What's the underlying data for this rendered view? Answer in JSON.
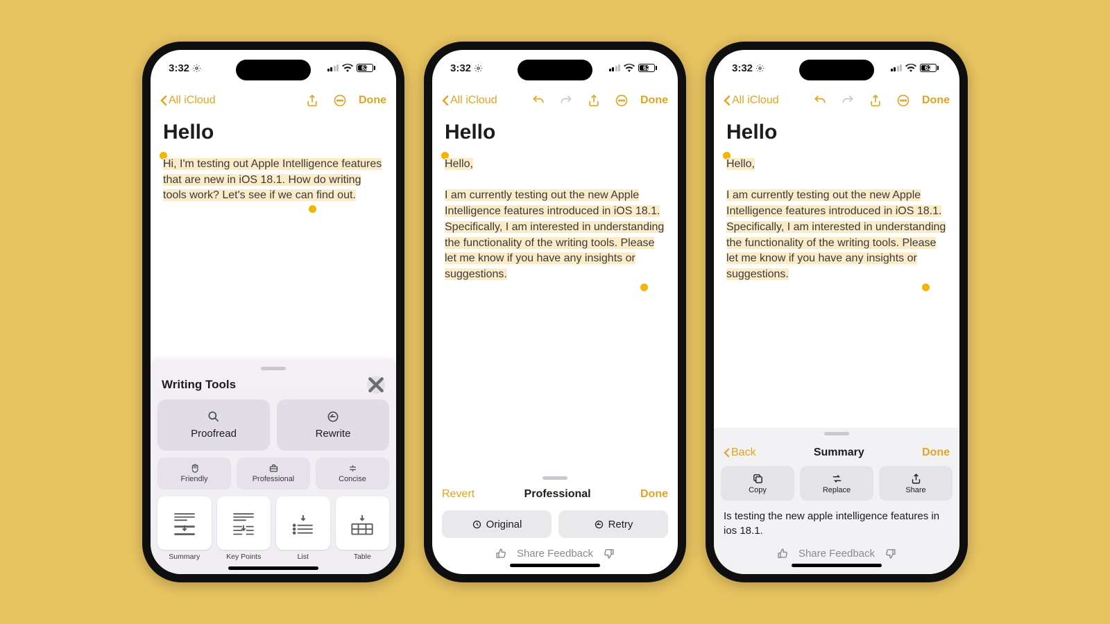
{
  "status": {
    "time": "3:32",
    "battery": "62"
  },
  "nav": {
    "back_label": "All iCloud",
    "done_label": "Done"
  },
  "note": {
    "title": "Hello",
    "body_original": "Hi, I'm testing out Apple Intelligence features that are new in iOS 18.1. How do writing tools work? Let's see if we can find out.",
    "body_rewritten": "Hello,\n\nI am currently testing out the new Apple Intelligence features introduced in iOS 18.1. Specifically, I am interested in understanding the functionality of the writing tools. Please let me know if you have any insights or suggestions."
  },
  "writing_tools": {
    "title": "Writing Tools",
    "primary": [
      "Proofread",
      "Rewrite"
    ],
    "tones": [
      "Friendly",
      "Professional",
      "Concise"
    ],
    "transforms": [
      "Summary",
      "Key Points",
      "List",
      "Table"
    ]
  },
  "panel2": {
    "revert": "Revert",
    "mode_label": "Professional",
    "done": "Done",
    "original": "Original",
    "retry": "Retry",
    "feedback": "Share Feedback"
  },
  "panel3": {
    "back": "Back",
    "title": "Summary",
    "done": "Done",
    "copy": "Copy",
    "replace": "Replace",
    "share": "Share",
    "summary_text": "Is testing the new apple intelligence features in ios 18.1.",
    "feedback": "Share Feedback"
  }
}
